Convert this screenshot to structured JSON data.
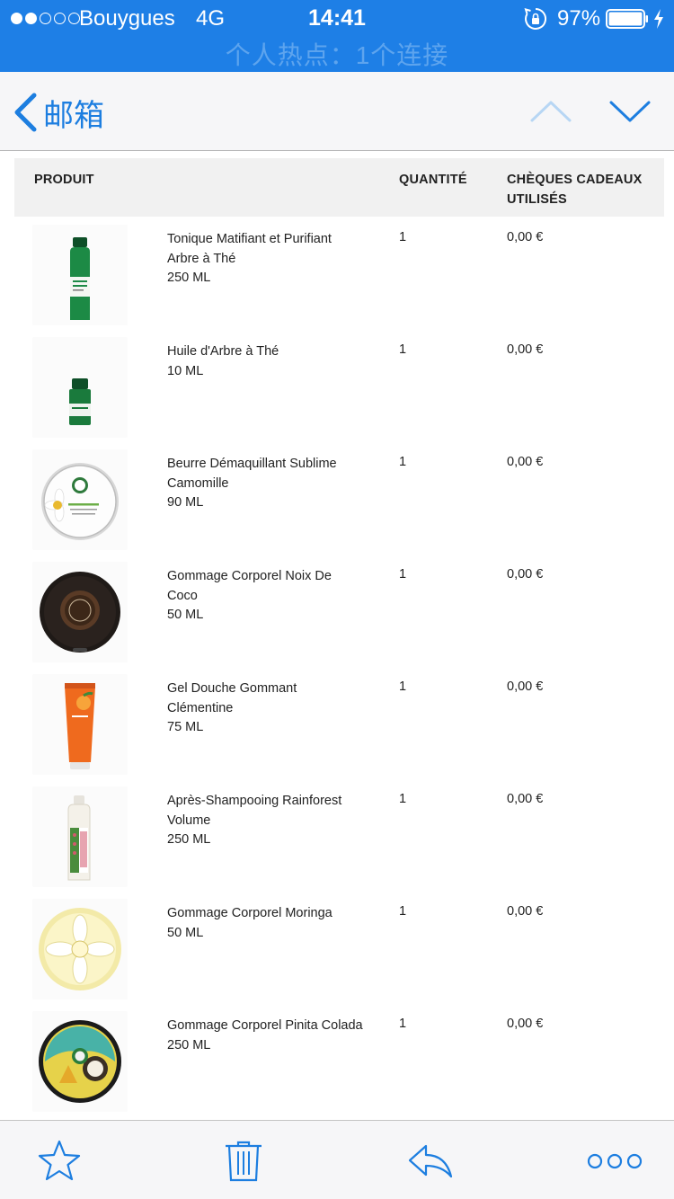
{
  "status_bar": {
    "carrier": "Bouygues",
    "network": "4G",
    "time": "14:41",
    "battery": "97%",
    "hotspot": "个人热点：1个连接",
    "signal_bars": 2,
    "signal_total": 5,
    "icons": [
      "orientation-lock-icon",
      "battery-icon",
      "charging-icon"
    ]
  },
  "nav": {
    "back_label": "邮箱",
    "icons": [
      "back-chevron-icon",
      "chevron-up-icon",
      "chevron-down-icon"
    ]
  },
  "table": {
    "headers": {
      "product": "PRODUIT",
      "quantity": "QUANTITÉ",
      "cheques": "CHÈQUES CADEAUX UTILISÉS"
    },
    "rows": [
      {
        "name": "Tonique Matifiant et Purifiant Arbre à Thé",
        "size": "250 ML",
        "quantity": "1",
        "price": "0,00 €",
        "image": "tea-tree-toner-bottle"
      },
      {
        "name": "Huile d'Arbre à Thé",
        "size": "10 ML",
        "quantity": "1",
        "price": "0,00 €",
        "image": "tea-tree-oil-bottle"
      },
      {
        "name": "Beurre Démaquillant Sublime Camomille",
        "size": "90 ML",
        "quantity": "1",
        "price": "0,00 €",
        "image": "camomile-butter-jar"
      },
      {
        "name": "Gommage Corporel Noix De Coco",
        "size": "50 ML",
        "quantity": "1",
        "price": "0,00 €",
        "image": "coconut-scrub-jar"
      },
      {
        "name": "Gel Douche Gommant Clémentine",
        "size": "75 ML",
        "quantity": "1",
        "price": "0,00 €",
        "image": "clementine-shower-tube"
      },
      {
        "name": "Après-Shampooing Rainforest Volume",
        "size": "250 ML",
        "quantity": "1",
        "price": "0,00 €",
        "image": "rainforest-conditioner-bottle"
      },
      {
        "name": "Gommage Corporel Moringa",
        "size": "50 ML",
        "quantity": "1",
        "price": "0,00 €",
        "image": "moringa-scrub-jar"
      },
      {
        "name": "Gommage Corporel Pinita Colada",
        "size": "250 ML",
        "quantity": "1",
        "price": "0,00 €",
        "image": "pinita-colada-scrub-jar"
      }
    ]
  },
  "toolbar": {
    "icons": [
      "star-icon",
      "trash-icon",
      "reply-icon",
      "more-icon"
    ]
  },
  "colors": {
    "status_bar": "#1e7fe6",
    "accent": "#1d7ee0",
    "header_bg": "#f1f1f1",
    "toolbar_bg": "#f6f6f8"
  }
}
